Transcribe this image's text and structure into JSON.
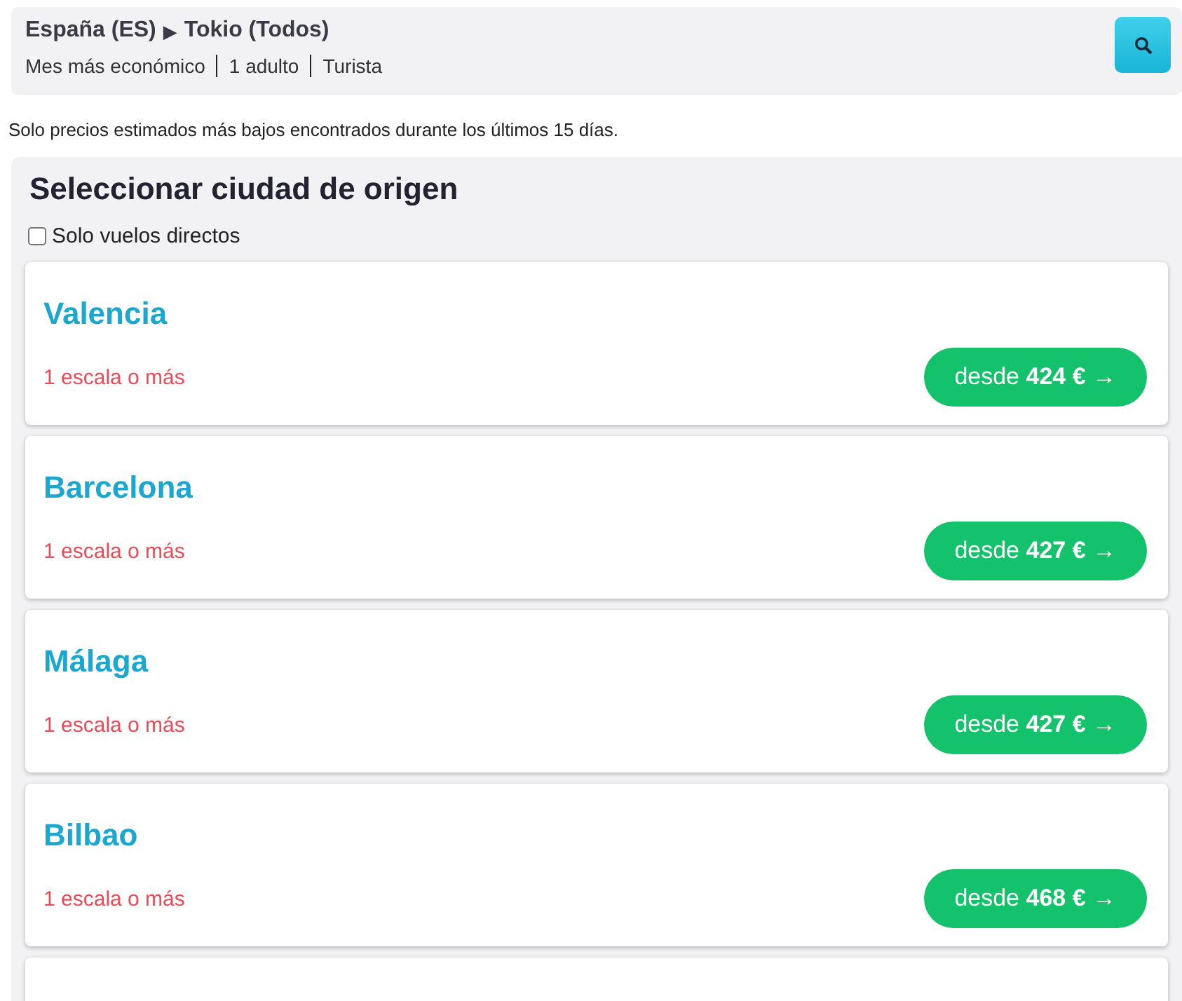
{
  "header": {
    "route_from": "España (ES)",
    "route_separator": "▶",
    "route_to": "Tokio (Todos)",
    "details": [
      "Mes más económico",
      "1 adulto",
      "Turista"
    ]
  },
  "notice": "Solo precios estimados más bajos encontrados durante los últimos 15 días.",
  "panel": {
    "title": "Seleccionar ciudad de origen",
    "filter": {
      "label": "Solo vuelos directos",
      "checked": false
    }
  },
  "cities": [
    {
      "name": "Valencia",
      "stops": "1 escala o más",
      "price": "desde **424 € →**"
    },
    {
      "name": "Barcelona",
      "stops": "1 escala o más",
      "price": "desde **427 € →**"
    },
    {
      "name": "Málaga",
      "stops": "1 escala o más",
      "price": "desde **427 € →**"
    },
    {
      "name": "Bilbao",
      "stops": "1 escala o más",
      "price": "desde **468 € →**"
    }
  ]
}
